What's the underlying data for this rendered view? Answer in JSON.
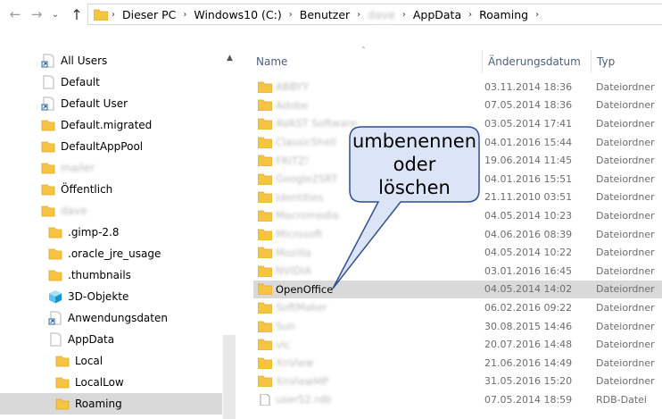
{
  "address_bar": {
    "crumbs": [
      "Dieser PC",
      "Windows10 (C:)",
      "Benutzer",
      "dave",
      "AppData",
      "Roaming"
    ]
  },
  "nav_tree": [
    {
      "label": "All Users",
      "icon": "shortcut-folder-icon"
    },
    {
      "label": "Default",
      "icon": "blank-folder-icon"
    },
    {
      "label": "Default User",
      "icon": "shortcut-folder-icon"
    },
    {
      "label": "Default.migrated",
      "icon": "folder-icon"
    },
    {
      "label": "DefaultAppPool",
      "icon": "folder-icon"
    },
    {
      "label": "mailer",
      "icon": "folder-icon",
      "blurred": true
    },
    {
      "label": "Öffentlich",
      "icon": "folder-icon"
    },
    {
      "label": "dave",
      "icon": "folder-icon",
      "blurred": true
    },
    {
      "label": ".gimp-2.8",
      "icon": "folder-icon"
    },
    {
      "label": ".oracle_jre_usage",
      "icon": "folder-icon"
    },
    {
      "label": ".thumbnails",
      "icon": "folder-icon"
    },
    {
      "label": "3D-Objekte",
      "icon": "3d-objects-icon"
    },
    {
      "label": "Anwendungsdaten",
      "icon": "shortcut-folder-icon"
    },
    {
      "label": "AppData",
      "icon": "blank-folder-icon"
    },
    {
      "label": "Local",
      "icon": "folder-icon"
    },
    {
      "label": "LocalLow",
      "icon": "folder-icon"
    },
    {
      "label": "Roaming",
      "icon": "folder-icon",
      "selected": true
    }
  ],
  "columns": {
    "name": "Name",
    "date": "Änderungsdatum",
    "type": "Typ"
  },
  "files": [
    {
      "name": "ABBYY",
      "date": "03.11.2014 18:36",
      "type": "Dateiordner",
      "blurred": true
    },
    {
      "name": "Adobe",
      "date": "07.05.2014 18:36",
      "type": "Dateiordner",
      "blurred": true
    },
    {
      "name": "AVAST Software",
      "date": "03.05.2014 17:41",
      "type": "Dateiordner",
      "blurred": true
    },
    {
      "name": "ClassicShell",
      "date": "04.01.2016 15:44",
      "type": "Dateiordner",
      "blurred": true
    },
    {
      "name": "FRITZ!",
      "date": "19.06.2014 11:45",
      "type": "Dateiordner",
      "blurred": true
    },
    {
      "name": "Google2SRT",
      "date": "04.01.2016 15:51",
      "type": "Dateiordner",
      "blurred": true
    },
    {
      "name": "Identities",
      "date": "21.11.2010 03:51",
      "type": "Dateiordner",
      "blurred": true
    },
    {
      "name": "Macromedia",
      "date": "04.05.2014 10:23",
      "type": "Dateiordner",
      "blurred": true
    },
    {
      "name": "Microsoft",
      "date": "04.06.2016 08:39",
      "type": "Dateiordner",
      "blurred": true
    },
    {
      "name": "Mozilla",
      "date": "04.05.2014 10:22",
      "type": "Dateiordner",
      "blurred": true
    },
    {
      "name": "NVIDIA",
      "date": "03.01.2016 16:45",
      "type": "Dateiordner",
      "blurred": true
    },
    {
      "name": "OpenOffice",
      "date": "04.05.2014 14:02",
      "type": "Dateiordner",
      "selected": true
    },
    {
      "name": "SoftMaker",
      "date": "06.02.2016 09:22",
      "type": "Dateiordner",
      "blurred": true
    },
    {
      "name": "Sun",
      "date": "30.08.2015 14:46",
      "type": "Dateiordner",
      "blurred": true
    },
    {
      "name": "vlc",
      "date": "20.07.2016 14:48",
      "type": "Dateiordner",
      "blurred": true
    },
    {
      "name": "XnView",
      "date": "21.06.2016 14:49",
      "type": "Dateiordner",
      "blurred": true
    },
    {
      "name": "XnViewMP",
      "date": "31.05.2016 15:20",
      "type": "Dateiordner",
      "blurred": true
    },
    {
      "name": "user52.rdb",
      "date": "07.05.2014 18:59",
      "type": "RDB-Datei",
      "blurred": true,
      "file": true
    }
  ],
  "callout": {
    "line1": "umbenennen",
    "line2": "oder",
    "line3": "löschen"
  },
  "colors": {
    "folder": "#f5c542",
    "folder_dark": "#e1a82a",
    "selection": "#d9d9d9",
    "callout_fill": "#dce4f7",
    "callout_stroke": "#2f4f8f",
    "header_text": "#4c607a"
  }
}
